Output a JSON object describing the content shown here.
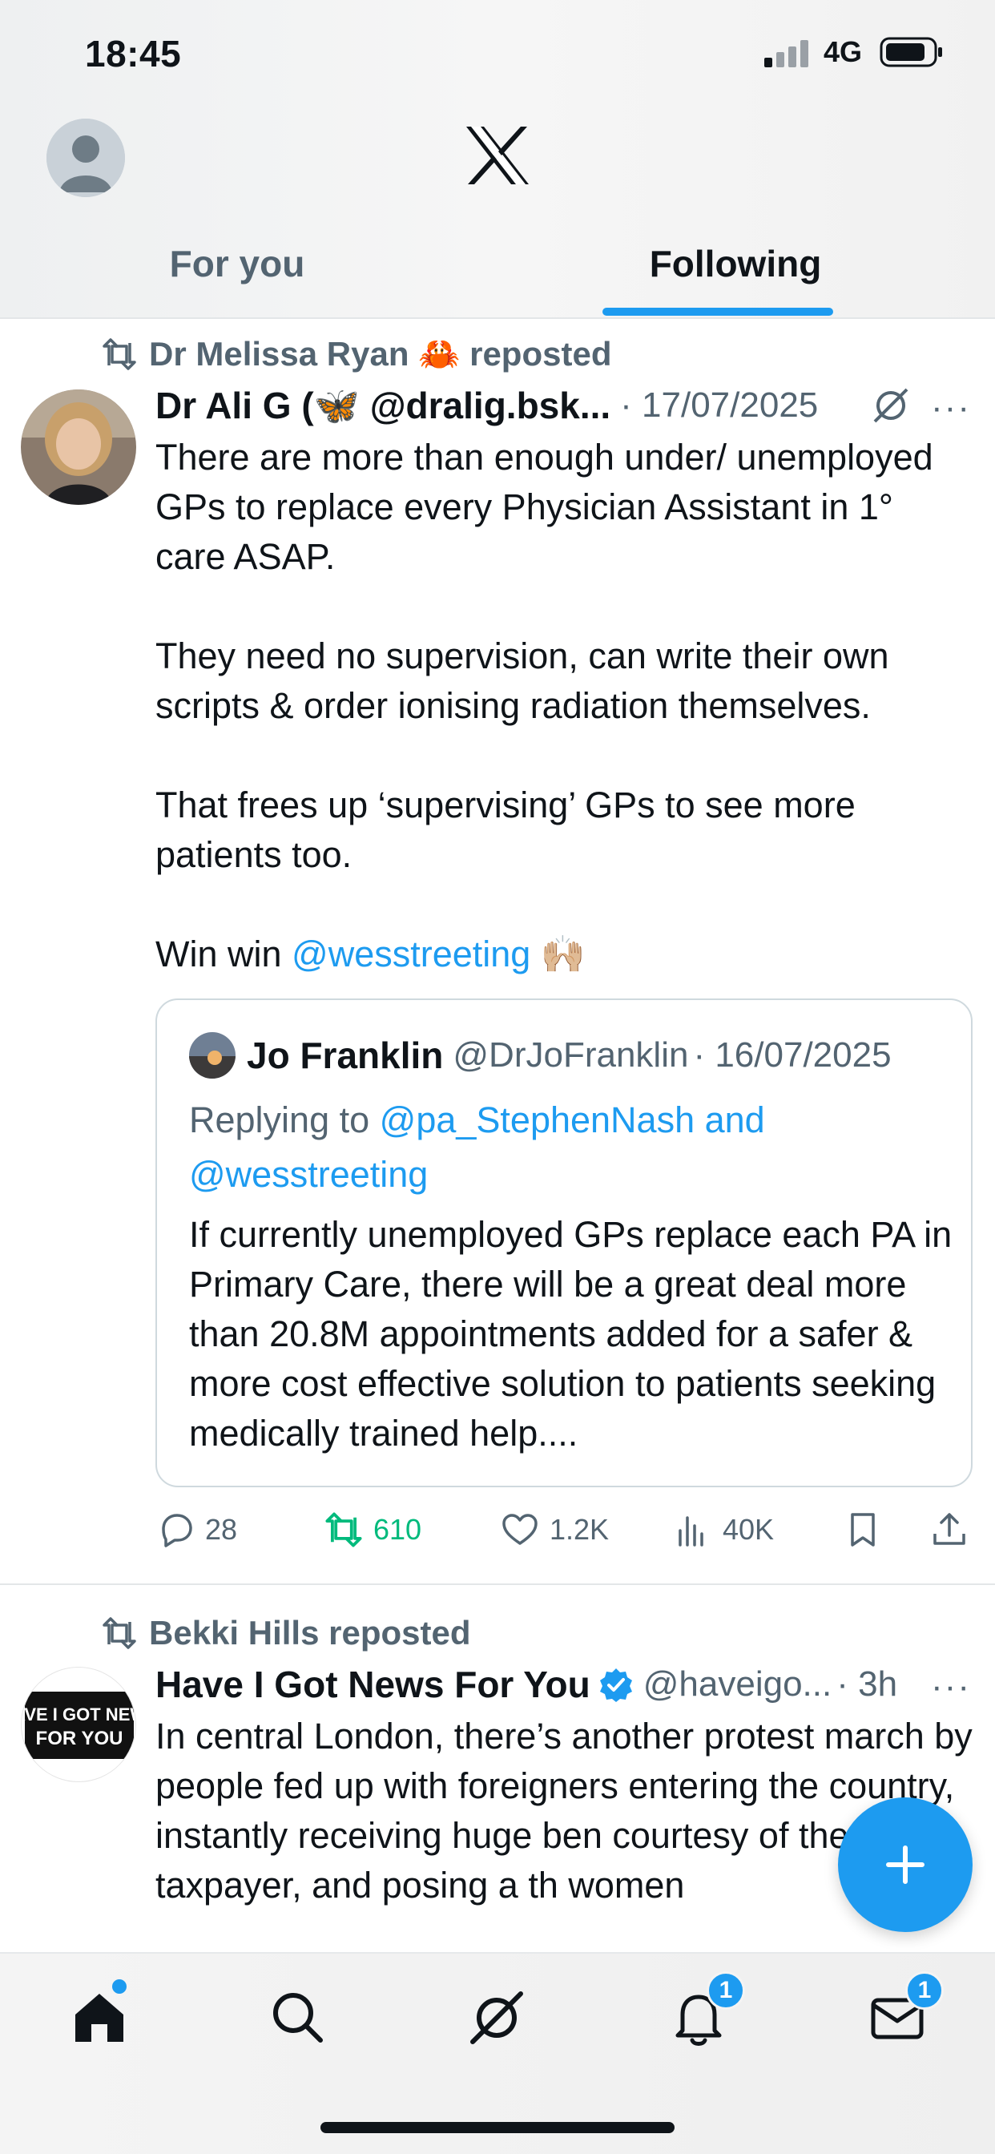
{
  "status_bar": {
    "time": "18:45",
    "network": "4G"
  },
  "header": {
    "logo": "x-logo"
  },
  "tabs": [
    {
      "label": "For you",
      "active": false
    },
    {
      "label": "Following",
      "active": true
    }
  ],
  "posts": [
    {
      "reposted_by": "Dr Melissa Ryan 🦀 reposted",
      "author": "Dr Ali G (🦋 @dralig.bsk...",
      "meta": "· 17/07/2025",
      "paragraphs": [
        "There are more than enough under/ unemployed GPs to replace every Physician Assistant in 1° care ASAP.",
        "They need no supervision, can write their own scripts & order ionising radiation themselves.",
        "That frees up ‘supervising’ GPs to see more patients too."
      ],
      "last_line_prefix": "Win win ",
      "last_line_mention": "@wesstreeting",
      "last_line_emoji": "🙌🏼",
      "quote": {
        "author": "Jo Franklin",
        "handle": "@DrJoFranklin",
        "date": "· 16/07/2025",
        "replying_prefix": "Replying to ",
        "replying_mention1": "@pa_StephenNash",
        "replying_and": " and",
        "replying_mention2": "@wesstreeting",
        "text": "If currently unemployed GPs replace each PA in Primary Care, there will be a great deal more than 20.8M appointments added for a safer & more cost effective solution to patients seeking medically trained help...."
      },
      "actions": {
        "replies": "28",
        "reposts": "610",
        "likes": "1.2K",
        "views": "40K"
      }
    },
    {
      "reposted_by": "Bekki Hills reposted",
      "author": "Have I Got News For You",
      "handle": "@haveigo...",
      "meta": "· 3h",
      "avatar_text": "HAVE I GOT NEWS FOR YOU",
      "text": "In central London, there’s another protest march by people fed up with foreigners entering the country, instantly receiving huge ben courtesy of the taxpayer, and posing a th women"
    }
  ],
  "bottom_nav": {
    "items": [
      "home-icon",
      "search-icon",
      "grok-icon",
      "notifications-icon",
      "messages-icon"
    ],
    "notifications_badge": "1",
    "messages_badge": "1"
  },
  "colors": {
    "accent": "#1d9bf0",
    "muted": "#536471",
    "repost_green": "#00ba7c"
  }
}
